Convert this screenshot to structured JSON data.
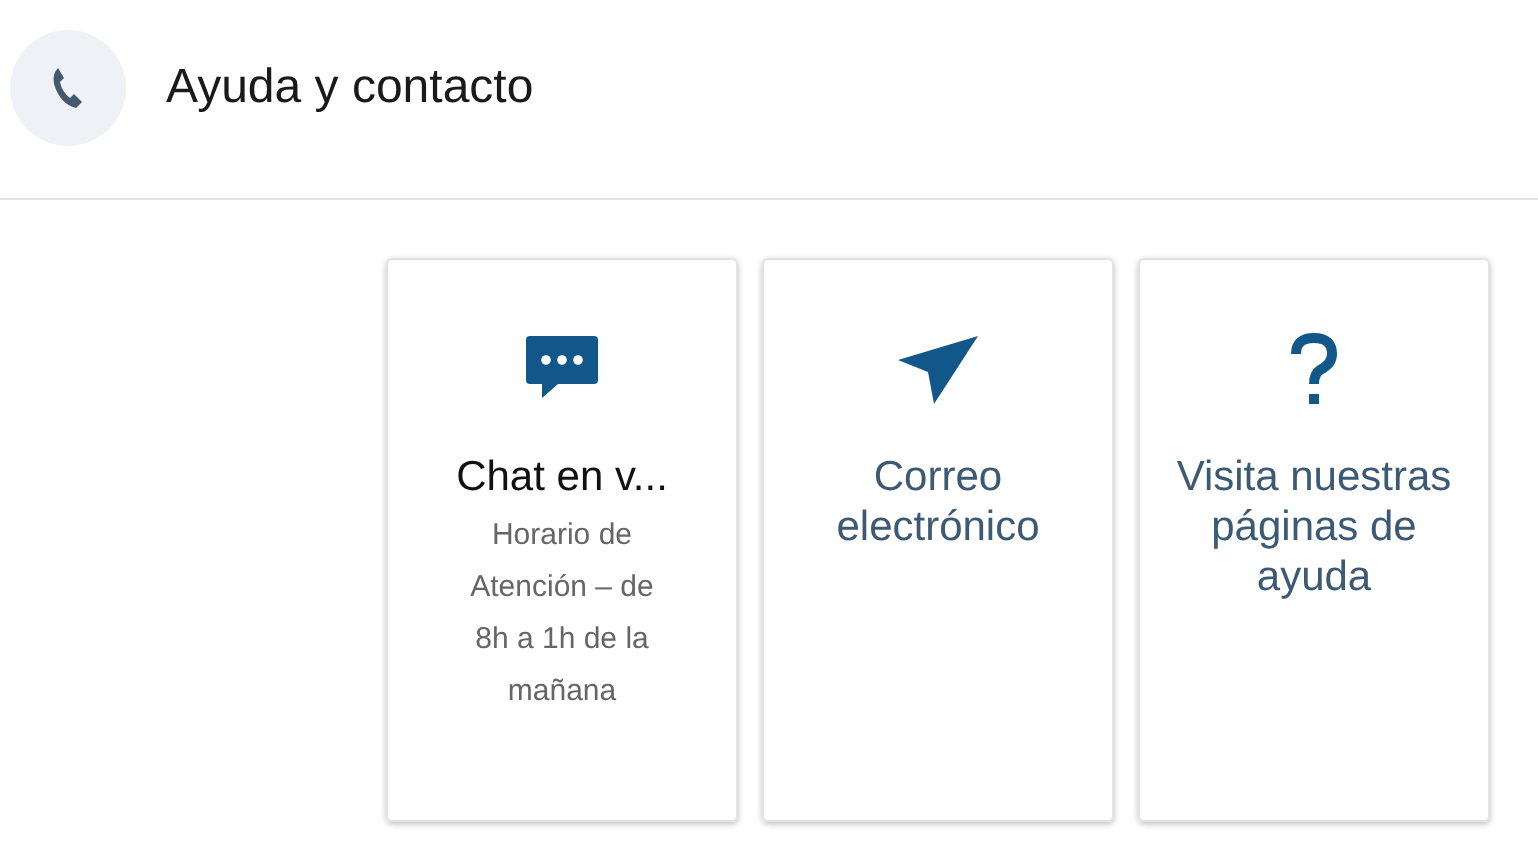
{
  "header": {
    "title": "Ayuda y contacto"
  },
  "cards": [
    {
      "kind": "chat",
      "title": "Chat en v...",
      "subtitle": "Horario de Atención – de 8h a 1h de la mañana"
    },
    {
      "kind": "email",
      "title": "Correo electrónico"
    },
    {
      "kind": "help",
      "title": "Visita nuestras páginas de ayuda"
    }
  ]
}
